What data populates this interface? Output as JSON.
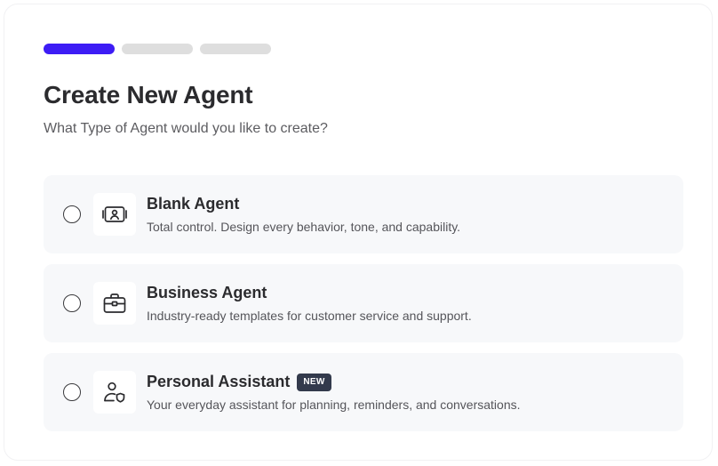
{
  "wizard": {
    "steps": [
      {
        "state": "active"
      },
      {
        "state": "inactive"
      },
      {
        "state": "inactive"
      }
    ],
    "title": "Create New Agent",
    "subtitle": "What Type of Agent would you like to create?"
  },
  "options": [
    {
      "title": "Blank Agent",
      "description": "Total control. Design every behavior, tone, and capability.",
      "icon": "agent-card-icon",
      "selected": false
    },
    {
      "title": "Business Agent",
      "description": "Industry-ready templates for customer service and support.",
      "icon": "briefcase-icon",
      "selected": false
    },
    {
      "title": "Personal Assistant",
      "badge": "NEW",
      "description": "Your everyday assistant for planning, reminders, and conversations.",
      "icon": "user-shield-icon",
      "selected": false
    }
  ],
  "colors": {
    "accent": "#3d1cf5",
    "step_inactive": "#dedede",
    "option_bg": "#f7f8fa",
    "badge_bg": "#333a4c",
    "text_primary": "#2b2b2e",
    "text_secondary": "#55555a"
  }
}
